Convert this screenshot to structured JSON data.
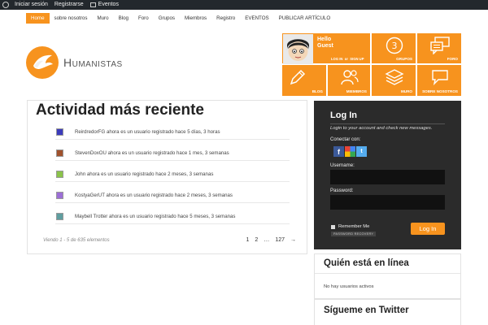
{
  "admin_bar": {
    "items": [
      "Iniciar sesión",
      "Registrarse",
      "Eventos"
    ]
  },
  "nav": {
    "items": [
      "Home",
      "sobre nosotros",
      "Muro",
      "Blog",
      "Foro",
      "Grupos",
      "Miembros",
      "Registro",
      "EVENTOS",
      "PUBLICAR ARTÍCULO"
    ],
    "active_index": 0
  },
  "logo": {
    "text": "Humanistas"
  },
  "tiles": {
    "hello": "Hello",
    "guest": "Guest",
    "log_in": "LOG IN",
    "or": "or",
    "sign_up": "SIGN UP",
    "grupos": "GRUPOS",
    "foro": "FORO",
    "blog": "BLOG",
    "miembros": "MIEMBROS",
    "muro": "MURO",
    "sobre_nosotros": "SOBRE NOSOTROS"
  },
  "main": {
    "title": "Actividad más reciente",
    "activities": [
      {
        "text": "ReirdredorFG ahora es un usuario registrado hace 5 días, 3 horas",
        "color": "#3b3bbb"
      },
      {
        "text": "StevenDoxOU ahora es un usuario registrado hace 1 mes, 3 semanas",
        "color": "#a0522d"
      },
      {
        "text": "John ahora es un usuario registrado hace 2 meses, 3 semanas",
        "color": "#8bc34a"
      },
      {
        "text": "KostyaGerUT ahora es un usuario registrado hace 2 meses, 3 semanas",
        "color": "#9c6fd6"
      },
      {
        "text": "Maybell Trotter ahora es un usuario registrado hace 5 meses, 3 semanas",
        "color": "#5f9ea0"
      }
    ],
    "pager_count": "Viendo 1 - 5 de 635 elementos",
    "pages": [
      "1",
      "2",
      "…",
      "127",
      "→"
    ]
  },
  "login": {
    "title": "Log In",
    "subtitle": "Login to your account and check new messages.",
    "connect": "Conectar con:",
    "username_label": "Username:",
    "password_label": "Password:",
    "remember": "Remember Me",
    "password_recovery": "PASSWORD RECOVERY",
    "button": "Log In",
    "accent": "#f7931e"
  },
  "online": {
    "title": "Quién está en línea",
    "empty": "No hay usuarios activos"
  },
  "twitter": {
    "title": "Sígueme en Twitter"
  }
}
